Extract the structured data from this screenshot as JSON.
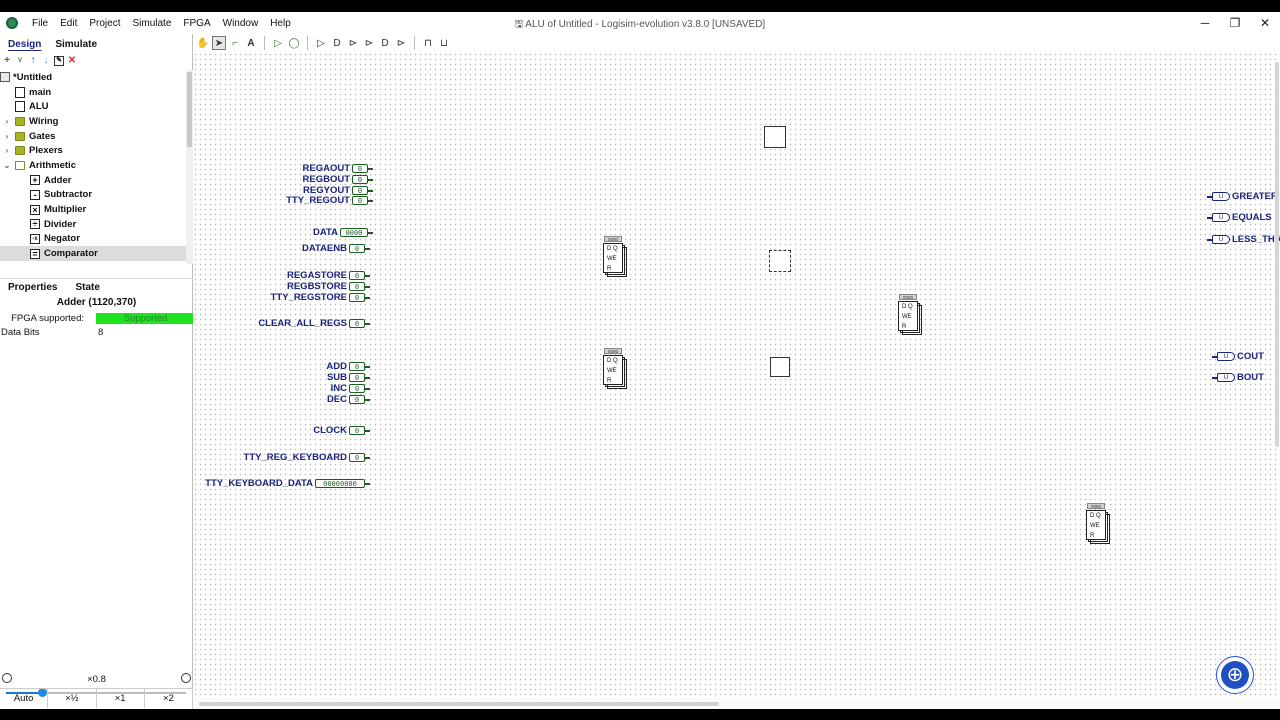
{
  "menu": [
    "File",
    "Edit",
    "Project",
    "Simulate",
    "FPGA",
    "Window",
    "Help"
  ],
  "window": {
    "title": "ALU of Untitled - Logisim-evolution v3.8.0 [UNSAVED]",
    "minimize": "─",
    "maximize": "❐",
    "close": "✕"
  },
  "left_tabs": {
    "design": "Design",
    "simulate": "Simulate"
  },
  "toolbox_icons": [
    "add-circuit-icon",
    "vhdl-icon",
    "move-up-icon",
    "move-down-icon",
    "edit-icon",
    "delete-icon"
  ],
  "tree": {
    "root": "*Untitled",
    "items": [
      {
        "label": "main",
        "kind": "circuit",
        "indent": 1
      },
      {
        "label": "ALU",
        "kind": "circuit",
        "indent": 1
      },
      {
        "label": "Wiring",
        "kind": "folder",
        "indent": 0
      },
      {
        "label": "Gates",
        "kind": "folder",
        "indent": 0
      },
      {
        "label": "Plexers",
        "kind": "folder",
        "indent": 0
      },
      {
        "label": "Arithmetic",
        "kind": "folder-open",
        "indent": 0
      },
      {
        "label": "Adder",
        "kind": "comp",
        "glyph": "+",
        "indent": 2
      },
      {
        "label": "Subtractor",
        "kind": "comp",
        "glyph": "-",
        "indent": 2
      },
      {
        "label": "Multiplier",
        "kind": "comp",
        "glyph": "×",
        "indent": 2
      },
      {
        "label": "Divider",
        "kind": "comp",
        "glyph": "÷",
        "indent": 2
      },
      {
        "label": "Negator",
        "kind": "comp",
        "glyph": "-x",
        "indent": 2
      },
      {
        "label": "Comparator",
        "kind": "comp",
        "glyph": "=",
        "indent": 2,
        "selected": true
      }
    ]
  },
  "props_tabs": {
    "properties": "Properties",
    "state": "State"
  },
  "props": {
    "title": "Adder (1120,370)",
    "fpga_key": "FPGA supported:",
    "fpga_val": "Supported",
    "bits_key": "Data Bits",
    "bits_val": "8"
  },
  "zoom": {
    "label": "×0.8",
    "level": 0.2,
    "buttons": [
      "Auto",
      "×½",
      "×1",
      "×2"
    ]
  },
  "toolbar_tools": [
    "hand-icon",
    "select-arrow-icon",
    "wire-icon",
    "text-icon",
    "input-pin-icon",
    "output-pin-icon",
    "not-gate-icon",
    "and-gate-icon",
    "or-gate-icon",
    "xor-gate-icon",
    "nand-gate-icon",
    "nor-gate-icon",
    "layout-icon",
    "appearance-icon"
  ],
  "canvas": {
    "inputs": [
      {
        "label": "REGAOUT",
        "value": "0"
      },
      {
        "label": "REGBOUT",
        "value": "0"
      },
      {
        "label": "REGYOUT",
        "value": "0"
      },
      {
        "label": "TTY_REGOUT",
        "value": "0"
      },
      {
        "label": "DATA",
        "value": "0000"
      },
      {
        "label": "DATAENB",
        "value": "0"
      },
      {
        "label": "REGASTORE",
        "value": "0"
      },
      {
        "label": "REGBSTORE",
        "value": "0"
      },
      {
        "label": "TTY_REGSTORE",
        "value": "0"
      },
      {
        "label": "CLEAR_ALL_REGS",
        "value": "0"
      },
      {
        "label": "ADD",
        "value": "0"
      },
      {
        "label": "SUB",
        "value": "0"
      },
      {
        "label": "INC",
        "value": "0"
      },
      {
        "label": "DEC",
        "value": "0"
      },
      {
        "label": "CLOCK",
        "value": "0"
      },
      {
        "label": "TTY_REG_KEYBOARD",
        "value": "0"
      },
      {
        "label": "TTY_KEYBOARD_DATA",
        "value": "00000000"
      }
    ],
    "outputs": [
      {
        "label": "GREATER",
        "value": "U"
      },
      {
        "label": "EQUALS",
        "value": "U"
      },
      {
        "label": "LESS_THA",
        "value": "U"
      },
      {
        "label": "COUT",
        "value": "U"
      },
      {
        "label": "BOUT",
        "value": "U"
      }
    ],
    "register": {
      "tag": "0000",
      "d": "D",
      "q": "Q",
      "we": "WE",
      "r": "R"
    }
  }
}
